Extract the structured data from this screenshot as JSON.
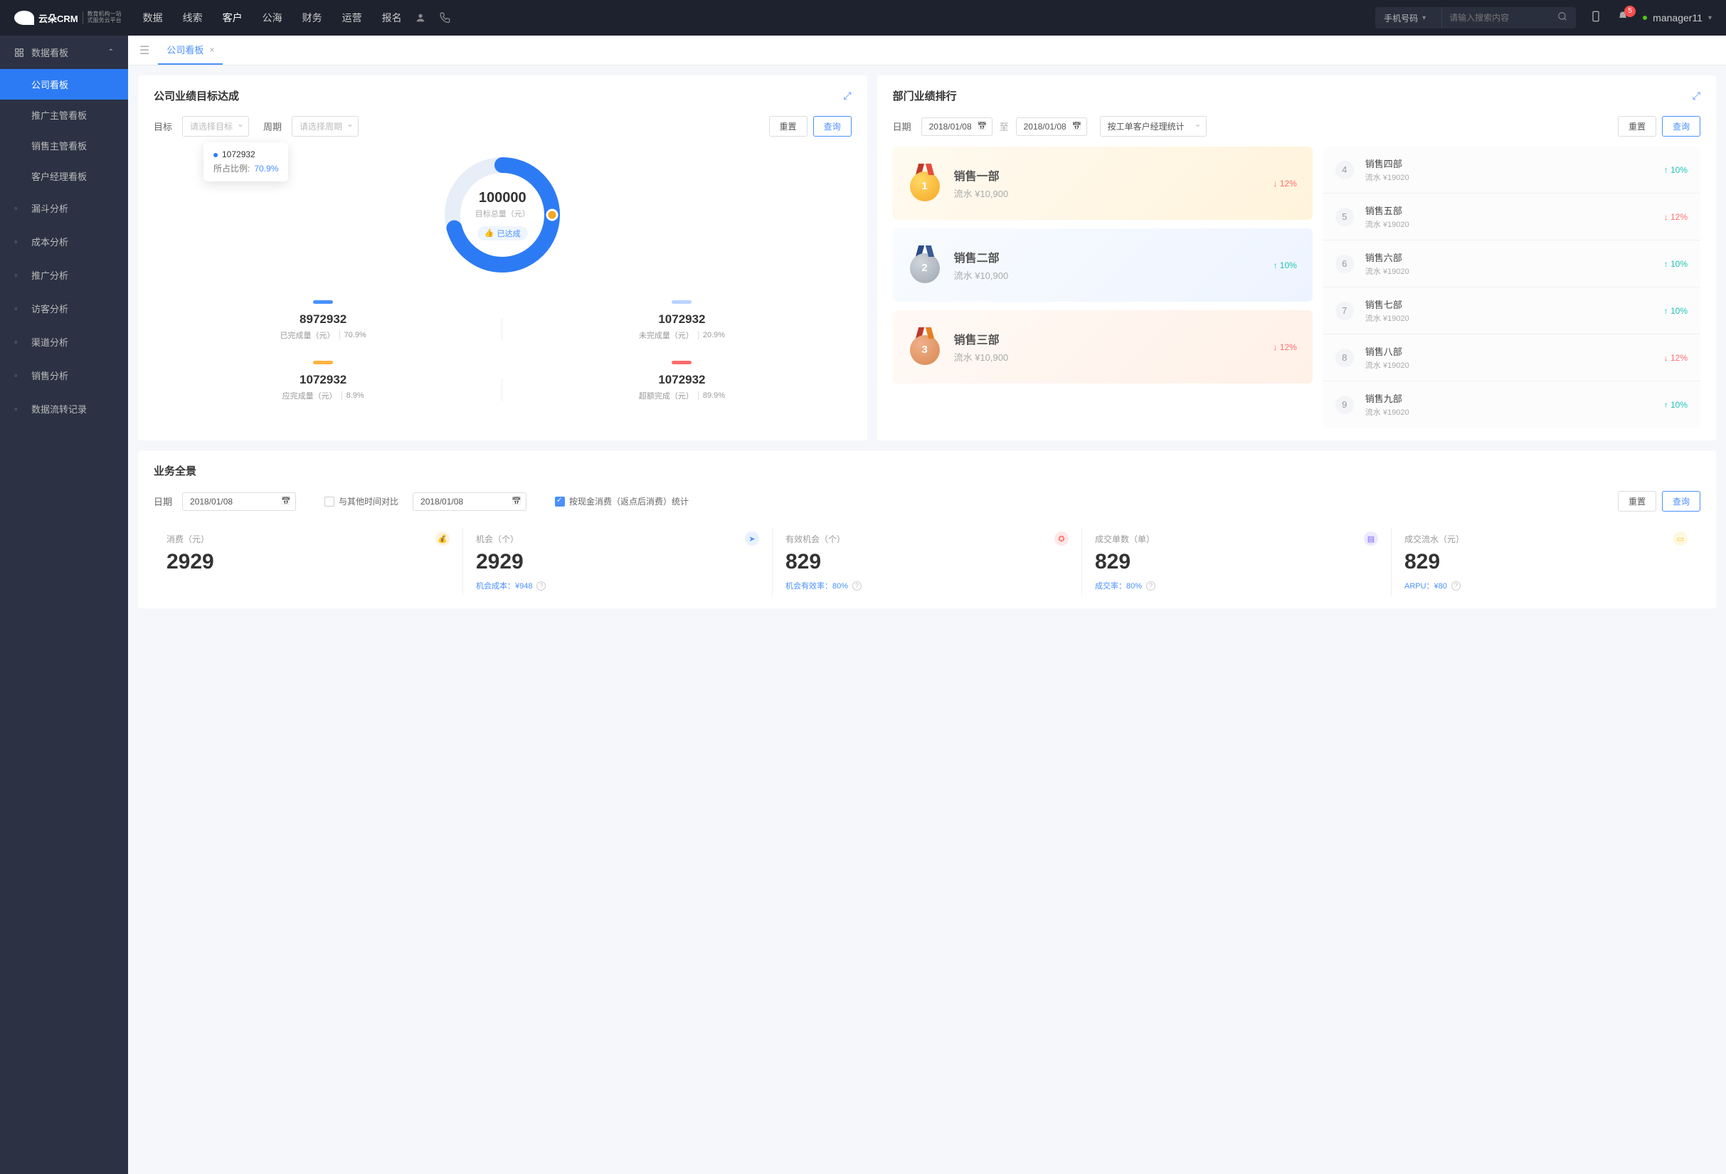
{
  "topbar": {
    "logo": "云朵CRM",
    "logoSub1": "教育机构一站",
    "logoSub2": "式服务云平台",
    "nav": [
      "数据",
      "线索",
      "客户",
      "公海",
      "财务",
      "运营",
      "报名"
    ],
    "activeNav": 2,
    "searchType": "手机号码",
    "searchPlaceholder": "请输入搜索内容",
    "badge": "5",
    "user": "manager11"
  },
  "sidebar": {
    "group": "数据看板",
    "children": [
      "公司看板",
      "推广主管看板",
      "销售主管看板",
      "客户经理看板"
    ],
    "activeChild": 0,
    "items": [
      "漏斗分析",
      "成本分析",
      "推广分析",
      "访客分析",
      "渠道分析",
      "销售分析",
      "数据流转记录"
    ]
  },
  "tab": {
    "label": "公司看板"
  },
  "targetCard": {
    "title": "公司业绩目标达成",
    "targetLabel": "目标",
    "targetPlaceholder": "请选择目标",
    "periodLabel": "周期",
    "periodPlaceholder": "请选择周期",
    "reset": "重置",
    "query": "查询",
    "tooltip": {
      "value": "1072932",
      "ratioLabel": "所占比例:",
      "ratio": "70.9%"
    },
    "donut": {
      "center": "100000",
      "label": "目标总量（元）",
      "badge": "已达成",
      "percent": 70.9
    },
    "metrics": [
      {
        "num": "8972932",
        "label": "已完成量（元）",
        "pct": "70.9%",
        "bar": "bar-blue"
      },
      {
        "num": "1072932",
        "label": "未完成量（元）",
        "pct": "20.9%",
        "bar": "bar-lightblue"
      },
      {
        "num": "1072932",
        "label": "应完成量（元）",
        "pct": "8.9%",
        "bar": "bar-orange"
      },
      {
        "num": "1072932",
        "label": "超额完成（元）",
        "pct": "89.9%",
        "bar": "bar-red"
      }
    ]
  },
  "rankCard": {
    "title": "部门业绩排行",
    "dateLabel": "日期",
    "dateFrom": "2018/01/08",
    "dateTo": "2018/01/08",
    "sep": "至",
    "statBy": "按工单客户经理统计",
    "reset": "重置",
    "query": "查询",
    "top3": [
      {
        "rank": "1",
        "name": "销售一部",
        "sub": "流水 ¥10,900",
        "trend": "12%",
        "dir": "down"
      },
      {
        "rank": "2",
        "name": "销售二部",
        "sub": "流水 ¥10,900",
        "trend": "10%",
        "dir": "up"
      },
      {
        "rank": "3",
        "name": "销售三部",
        "sub": "流水 ¥10,900",
        "trend": "12%",
        "dir": "down"
      }
    ],
    "list": [
      {
        "rank": "4",
        "name": "销售四部",
        "sub": "流水 ¥19020",
        "trend": "10%",
        "dir": "up"
      },
      {
        "rank": "5",
        "name": "销售五部",
        "sub": "流水 ¥19020",
        "trend": "12%",
        "dir": "down"
      },
      {
        "rank": "6",
        "name": "销售六部",
        "sub": "流水 ¥19020",
        "trend": "10%",
        "dir": "up"
      },
      {
        "rank": "7",
        "name": "销售七部",
        "sub": "流水 ¥19020",
        "trend": "10%",
        "dir": "up"
      },
      {
        "rank": "8",
        "name": "销售八部",
        "sub": "流水 ¥19020",
        "trend": "12%",
        "dir": "down"
      },
      {
        "rank": "9",
        "name": "销售九部",
        "sub": "流水 ¥19020",
        "trend": "10%",
        "dir": "up"
      }
    ]
  },
  "overview": {
    "title": "业务全景",
    "dateLabel": "日期",
    "date1": "2018/01/08",
    "compare": "与其他时间对比",
    "date2": "2018/01/08",
    "check": "按现金消费（返点后消费）统计",
    "reset": "重置",
    "query": "查询",
    "kpis": [
      {
        "label": "消费（元）",
        "value": "2929",
        "sub": "",
        "icon": "icn-orange",
        "glyph": "💰"
      },
      {
        "label": "机会（个）",
        "value": "2929",
        "sub": "机会成本：¥948",
        "icon": "icn-blue",
        "glyph": "➤"
      },
      {
        "label": "有效机会（个）",
        "value": "829",
        "sub": "机会有效率：80%",
        "icon": "icn-red",
        "glyph": "✪"
      },
      {
        "label": "成交单数（单）",
        "value": "829",
        "sub": "成交率：80%",
        "icon": "icn-purple",
        "glyph": "▤"
      },
      {
        "label": "成交流水（元）",
        "value": "829",
        "sub": "ARPU：¥80",
        "icon": "icn-yellow",
        "glyph": "▭"
      }
    ]
  },
  "chart_data": {
    "type": "pie",
    "title": "公司业绩目标达成",
    "total": 100000,
    "series": [
      {
        "name": "已完成量",
        "value": 8972932,
        "pct": 70.9
      },
      {
        "name": "未完成量",
        "value": 1072932,
        "pct": 20.9
      },
      {
        "name": "应完成量",
        "value": 1072932,
        "pct": 8.9
      },
      {
        "name": "超额完成",
        "value": 1072932,
        "pct": 89.9
      }
    ]
  }
}
